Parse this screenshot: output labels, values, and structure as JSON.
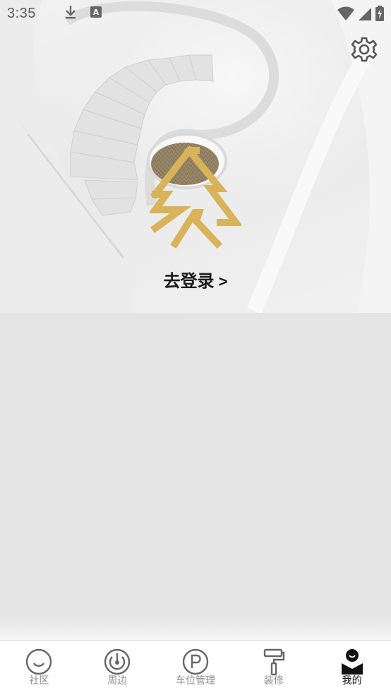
{
  "status_bar": {
    "time": "3:35",
    "icons_left": [
      "download-icon",
      "keyboard-a-icon"
    ],
    "icons_right": [
      "wifi-icon",
      "cell-signal-icon",
      "battery-charging-icon"
    ]
  },
  "header": {
    "settings_icon": "gear-icon",
    "logo_icon": "brand-logo-icon",
    "login_label": "去登录",
    "login_chevron": ">"
  },
  "colors": {
    "logo_gold": "#d8b35a",
    "active_nav": "#111111",
    "inactive_nav": "#8a8a8a"
  },
  "bottom_nav": {
    "items": [
      {
        "label": "社区",
        "icon": "smile-face-icon",
        "active": false
      },
      {
        "label": "周边",
        "icon": "radar-icon",
        "active": false
      },
      {
        "label": "车位管理",
        "icon": "parking-icon",
        "active": false
      },
      {
        "label": "装修",
        "icon": "paint-roller-icon",
        "active": false
      },
      {
        "label": "我的",
        "icon": "user-profile-icon",
        "active": true
      }
    ]
  }
}
